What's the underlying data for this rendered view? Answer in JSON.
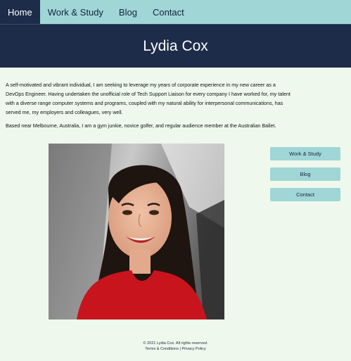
{
  "nav": {
    "items": [
      {
        "label": "Home"
      },
      {
        "label": "Work & Study"
      },
      {
        "label": "Blog"
      },
      {
        "label": "Contact"
      }
    ]
  },
  "header": {
    "title": "Lydia Cox"
  },
  "intro": {
    "paragraph1": "A self-motivated and vibrant individual, I am seeking to leverage my years of corporate experience in my new career as a DevOps Engineer. Having undertaken the unofficial role of Tech Support Liaison for every company I have worked for, my talent with a diverse range computer systems and programs, coupled with my natural ability for interpersonal communications, has served me, my employers and colleagues, very well.",
    "paragraph2": "Based near Melbourne, Australia, I am a gym junkie, novice golfer, and regular audience member at the Australian Ballet."
  },
  "sidebar": {
    "buttons": [
      {
        "label": "Work & Study"
      },
      {
        "label": "Blog"
      },
      {
        "label": "Contact"
      }
    ]
  },
  "footer": {
    "copyright": "© 2021 Lydia Cox. All rights reserved.",
    "terms": "Terms & Conditions",
    "separator": "|",
    "privacy": "Privacy Policy"
  },
  "colors": {
    "nav_bg": "#a0d6d6",
    "header_bg": "#1d2c49",
    "page_bg": "#eef8ec",
    "button_bg": "#a0d6d6"
  }
}
